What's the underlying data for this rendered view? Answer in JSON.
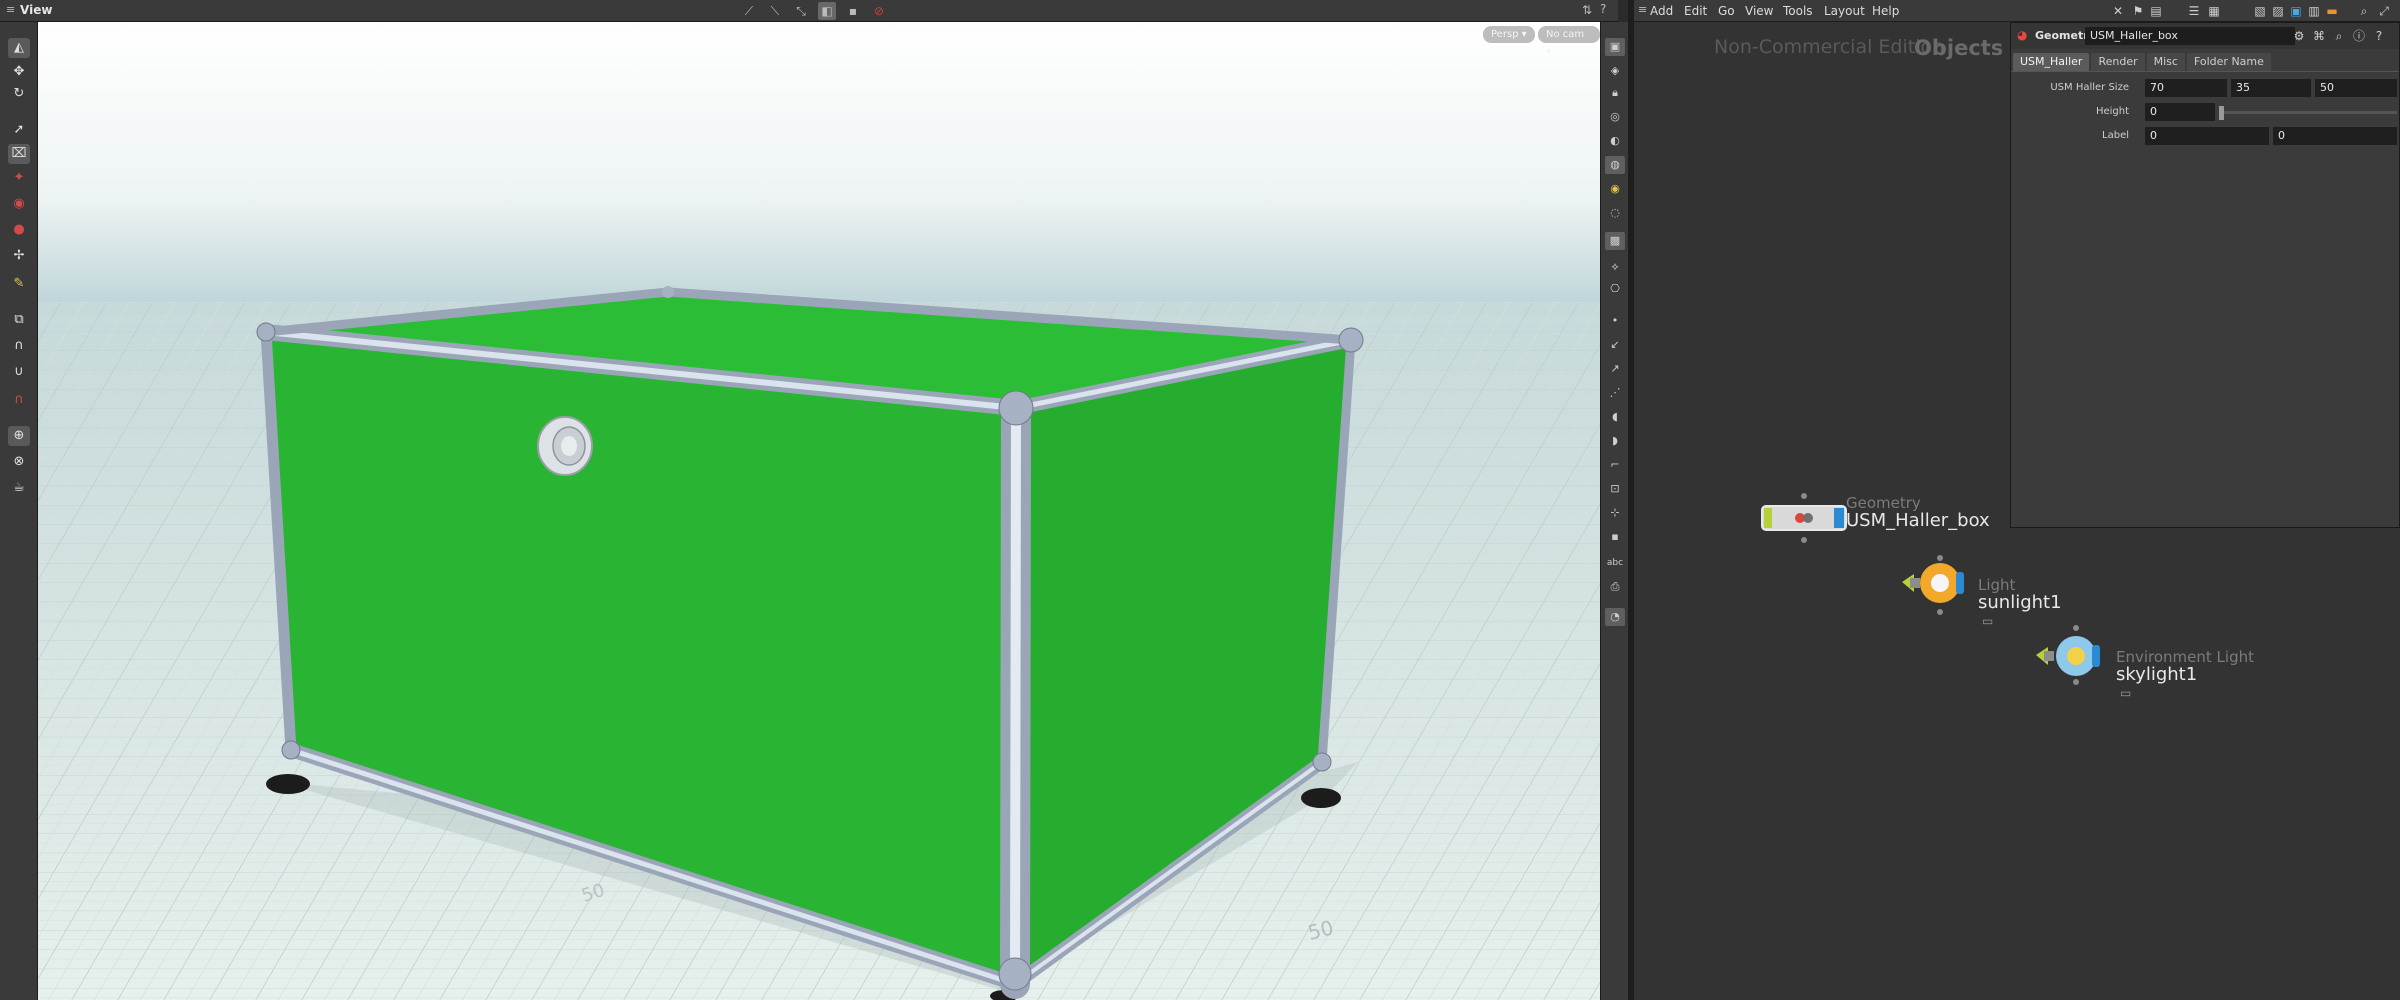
{
  "viewport": {
    "title": "View",
    "persp_label": "Persp ▾",
    "cam_label": "No cam ▾",
    "grid_labels": [
      "50",
      "50"
    ]
  },
  "network": {
    "menu": [
      "Add",
      "Edit",
      "Go",
      "View",
      "Tools",
      "Layout",
      "Help"
    ],
    "watermark": "Non-Commercial Edition",
    "context": "Objects",
    "nodes": [
      {
        "type": "Geometry",
        "name": "USM_Haller_box"
      },
      {
        "type": "Light",
        "name": "sunlight1"
      },
      {
        "type": "Environment Light",
        "name": "skylight1"
      }
    ]
  },
  "params": {
    "type_label": "Geometry",
    "node_name": "USM_Haller_box",
    "tabs": [
      "USM_Haller",
      "Render",
      "Misc",
      "Folder Name"
    ],
    "size_label": "USM Haller Size",
    "size_values": [
      "70",
      "35",
      "50"
    ],
    "height_label": "Height",
    "height_value": "0",
    "label_label": "Label",
    "label_values": [
      "0",
      "0"
    ]
  },
  "colors": {
    "box_green": "#2bb934",
    "frame": "#aeb8c8",
    "floor": "#dfeae6",
    "sky": "#b7cfd4"
  }
}
